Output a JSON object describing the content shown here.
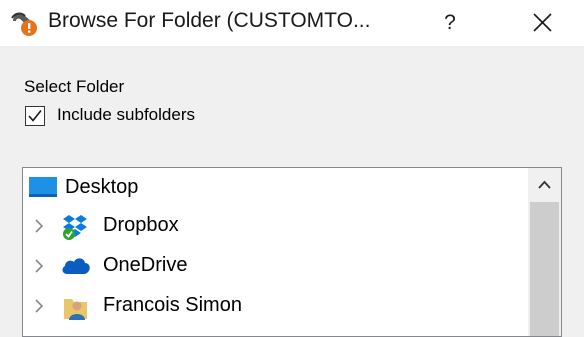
{
  "window": {
    "title": "Browse For Folder (CUSTOMTO...",
    "help_label": "?",
    "app_icon": "app-wrench-icon",
    "close_icon": "close-icon"
  },
  "dialog": {
    "select_label": "Select Folder",
    "include_subfolders": {
      "label": "Include subfolders",
      "checked": true
    }
  },
  "tree": {
    "items": [
      {
        "label": "Desktop",
        "icon": "desktop-icon",
        "expandable": false
      },
      {
        "label": "Dropbox",
        "icon": "dropbox-icon",
        "expandable": true
      },
      {
        "label": "OneDrive",
        "icon": "onedrive-icon",
        "expandable": true
      },
      {
        "label": "Francois Simon",
        "icon": "user-folder-icon",
        "expandable": true
      }
    ]
  },
  "scrollbar": {
    "up_icon": "chevron-up-icon"
  }
}
